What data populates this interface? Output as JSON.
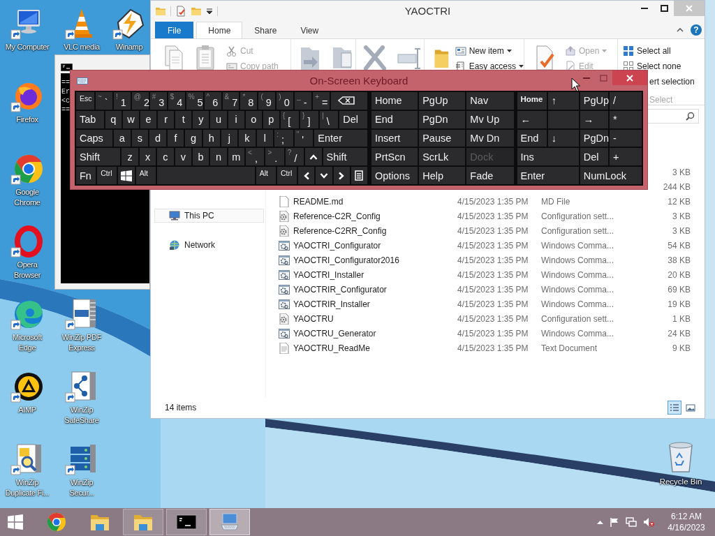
{
  "desktop_icons": [
    {
      "label": "My Computer",
      "kind": "computer"
    },
    {
      "label": "VLC media",
      "kind": "cone"
    },
    {
      "label": "Winamp",
      "kind": "bolt"
    },
    {
      "label": "Firefox",
      "kind": "firefox"
    },
    {
      "label": "Google Chrome",
      "kind": "chrome"
    },
    {
      "label": "Opera Browser",
      "kind": "opera"
    },
    {
      "label": "Microsoft Edge",
      "kind": "edge"
    },
    {
      "label": "WinZip PDF Express",
      "kind": "pdf"
    },
    {
      "label": "AIMP",
      "kind": "aimp"
    },
    {
      "label": "WinZip SafeShare",
      "kind": "share"
    },
    {
      "label": "WinZip Duplicate Fi...",
      "kind": "duplicate"
    },
    {
      "label": "WinZip Secur...",
      "kind": "secure"
    }
  ],
  "recycle_bin": {
    "label": "Recycle Bin"
  },
  "console": {
    "lines": [
      "==",
      "Er",
      "<c",
      "=="
    ]
  },
  "explorer": {
    "title": "YAOCTRI",
    "ribbon_tabs": [
      {
        "label": "File",
        "kind": "file",
        "selected": false
      },
      {
        "label": "Home",
        "kind": "tab",
        "selected": true
      },
      {
        "label": "Share",
        "kind": "tab",
        "selected": false
      },
      {
        "label": "View",
        "kind": "tab",
        "selected": false
      }
    ],
    "help_label": "?",
    "ribbon": {
      "clipboard": [
        {
          "label": "Cut",
          "disabled": true,
          "dropdown": false
        },
        {
          "label": "Copy path",
          "disabled": true,
          "dropdown": false
        }
      ],
      "new": [
        {
          "label": "New item",
          "disabled": false,
          "dropdown": true
        },
        {
          "label": "Easy access",
          "disabled": false,
          "dropdown": true
        }
      ],
      "open": [
        {
          "label": "Open",
          "disabled": true,
          "dropdown": true
        },
        {
          "label": "Edit",
          "disabled": true,
          "dropdown": false
        }
      ],
      "select": [
        {
          "label": "Select all",
          "disabled": false,
          "dropdown": false
        },
        {
          "label": "Select none",
          "disabled": false,
          "dropdown": false
        },
        {
          "label": "ert selection",
          "disabled": false,
          "dropdown": false
        }
      ],
      "select_label": "Select"
    },
    "nav": [
      {
        "label": "This PC",
        "kind": "pc",
        "selected": true
      },
      {
        "label": "Network",
        "kind": "network",
        "selected": false
      }
    ],
    "files": [
      {
        "size": "3 KB"
      },
      {
        "size": "244 KB"
      },
      {
        "name": "README.md",
        "date": "4/15/2023 1:35 PM",
        "type": "MD File",
        "size": "12 KB",
        "kind": "document"
      },
      {
        "name": "Reference-C2R_Config",
        "date": "4/15/2023 1:35 PM",
        "type": "Configuration sett...",
        "size": "3 KB",
        "kind": "settings"
      },
      {
        "name": "Reference-C2RR_Config",
        "date": "4/15/2023 1:35 PM",
        "type": "Configuration sett...",
        "size": "3 KB",
        "kind": "settings"
      },
      {
        "name": "YAOCTRI_Configurator",
        "date": "4/15/2023 1:35 PM",
        "type": "Windows Comma...",
        "size": "54 KB",
        "kind": "script"
      },
      {
        "name": "YAOCTRI_Configurator2016",
        "date": "4/15/2023 1:35 PM",
        "type": "Windows Comma...",
        "size": "38 KB",
        "kind": "script"
      },
      {
        "name": "YAOCTRI_Installer",
        "date": "4/15/2023 1:35 PM",
        "type": "Windows Comma...",
        "size": "20 KB",
        "kind": "script"
      },
      {
        "name": "YAOCTRIR_Configurator",
        "date": "4/15/2023 1:35 PM",
        "type": "Windows Comma...",
        "size": "69 KB",
        "kind": "script"
      },
      {
        "name": "YAOCTRIR_Installer",
        "date": "4/15/2023 1:35 PM",
        "type": "Windows Comma...",
        "size": "19 KB",
        "kind": "script"
      },
      {
        "name": "YAOCTRU",
        "date": "4/15/2023 1:35 PM",
        "type": "Configuration sett...",
        "size": "1 KB",
        "kind": "settings"
      },
      {
        "name": "YAOCTRU_Generator",
        "date": "4/15/2023 1:35 PM",
        "type": "Windows Comma...",
        "size": "24 KB",
        "kind": "script"
      },
      {
        "name": "YAOCTRU_ReadMe",
        "date": "4/15/2023 1:35 PM",
        "type": "Text Document",
        "size": "9 KB",
        "kind": "text"
      }
    ],
    "status": "14 items",
    "view_buttons": [
      {
        "kind": "details",
        "selected": true
      },
      {
        "kind": "thumbnails",
        "selected": false
      }
    ]
  },
  "keyboard": {
    "title": "On-Screen Keyboard",
    "main_rows": [
      [
        {
          "label": "Esc",
          "kind": "small"
        },
        {
          "shift": "~",
          "label": "`",
          "kind": "pair"
        },
        {
          "shift": "!",
          "label": "1",
          "kind": "pair"
        },
        {
          "shift": "@",
          "label": "2",
          "kind": "pair"
        },
        {
          "shift": "#",
          "label": "3",
          "kind": "pair"
        },
        {
          "shift": "$",
          "label": "4",
          "kind": "pair"
        },
        {
          "shift": "%",
          "label": "5",
          "kind": "pair"
        },
        {
          "shift": "^",
          "label": "6",
          "kind": "pair"
        },
        {
          "shift": "&",
          "label": "7",
          "kind": "pair"
        },
        {
          "shift": "*",
          "label": "8",
          "kind": "pair"
        },
        {
          "shift": "(",
          "label": "9",
          "kind": "pair"
        },
        {
          "shift": ")",
          "label": "0",
          "kind": "pair"
        },
        {
          "shift": "_",
          "label": "-",
          "kind": "pair"
        },
        {
          "shift": "+",
          "label": "=",
          "kind": "pair"
        },
        {
          "kind": "backspace"
        }
      ],
      [
        {
          "label": "Tab",
          "kind": "text"
        },
        {
          "label": "q",
          "kind": "letter"
        },
        {
          "label": "w",
          "kind": "letter"
        },
        {
          "label": "e",
          "kind": "letter"
        },
        {
          "label": "r",
          "kind": "letter"
        },
        {
          "label": "t",
          "kind": "letter"
        },
        {
          "label": "y",
          "kind": "letter"
        },
        {
          "label": "u",
          "kind": "letter"
        },
        {
          "label": "i",
          "kind": "letter"
        },
        {
          "label": "o",
          "kind": "letter"
        },
        {
          "label": "p",
          "kind": "letter"
        },
        {
          "shift": "{",
          "label": "[",
          "kind": "pair"
        },
        {
          "shift": "}",
          "label": "]",
          "kind": "pair"
        },
        {
          "shift": "|",
          "label": "\\",
          "kind": "pair"
        },
        {
          "label": "Del",
          "kind": "text"
        }
      ],
      [
        {
          "label": "Caps",
          "kind": "text"
        },
        {
          "label": "a",
          "kind": "letter"
        },
        {
          "label": "s",
          "kind": "letter"
        },
        {
          "label": "d",
          "kind": "letter"
        },
        {
          "label": "f",
          "kind": "letter"
        },
        {
          "label": "g",
          "kind": "letter"
        },
        {
          "label": "h",
          "kind": "letter"
        },
        {
          "label": "j",
          "kind": "letter"
        },
        {
          "label": "k",
          "kind": "letter"
        },
        {
          "label": "l",
          "kind": "letter"
        },
        {
          "shift": ":",
          "label": ";",
          "kind": "pair"
        },
        {
          "shift": "\"",
          "label": "'",
          "kind": "pair"
        },
        {
          "label": "Enter",
          "kind": "text"
        }
      ],
      [
        {
          "label": "Shift",
          "kind": "text"
        },
        {
          "label": "z",
          "kind": "letter"
        },
        {
          "label": "x",
          "kind": "letter"
        },
        {
          "label": "c",
          "kind": "letter"
        },
        {
          "label": "v",
          "kind": "letter"
        },
        {
          "label": "b",
          "kind": "letter"
        },
        {
          "label": "n",
          "kind": "letter"
        },
        {
          "label": "m",
          "kind": "letter"
        },
        {
          "shift": "<",
          "label": ",",
          "kind": "pair"
        },
        {
          "shift": ">",
          "label": ".",
          "kind": "pair"
        },
        {
          "shift": "?",
          "label": "/",
          "kind": "pair"
        },
        {
          "kind": "up"
        },
        {
          "label": "Shift",
          "kind": "text"
        }
      ],
      [
        {
          "label": "Fn",
          "kind": "text"
        },
        {
          "label": "Ctrl",
          "kind": "small"
        },
        {
          "kind": "windows"
        },
        {
          "label": "Alt",
          "kind": "small"
        },
        {
          "kind": "space"
        },
        {
          "label": "Alt",
          "kind": "small"
        },
        {
          "label": "Ctrl",
          "kind": "small"
        },
        {
          "kind": "left"
        },
        {
          "kind": "down"
        },
        {
          "kind": "right"
        },
        {
          "kind": "menu"
        }
      ]
    ],
    "side_rows": [
      [
        {
          "label": "Home",
          "kind": "text",
          "disabled": false
        },
        {
          "label": "PgUp",
          "kind": "text",
          "disabled": false
        },
        {
          "label": "Nav",
          "kind": "text",
          "disabled": false
        },
        {
          "label": "Home",
          "kind": "small",
          "disabled": false
        },
        {
          "label": "↑",
          "kind": "text",
          "disabled": false
        },
        {
          "label": "PgUp",
          "kind": "text",
          "disabled": false
        },
        {
          "label": "/",
          "kind": "text",
          "disabled": false
        }
      ],
      [
        {
          "label": "End",
          "kind": "text",
          "disabled": false
        },
        {
          "label": "PgDn",
          "kind": "text",
          "disabled": false
        },
        {
          "label": "Mv Up",
          "kind": "text",
          "disabled": false
        },
        {
          "label": "←",
          "kind": "text",
          "disabled": false
        },
        {
          "kind": "blank"
        },
        {
          "label": "→",
          "kind": "text",
          "disabled": false
        },
        {
          "label": "*",
          "kind": "text",
          "disabled": false
        }
      ],
      [
        {
          "label": "Insert",
          "kind": "text",
          "disabled": false
        },
        {
          "label": "Pause",
          "kind": "text",
          "disabled": false
        },
        {
          "label": "Mv Dn",
          "kind": "text",
          "disabled": false
        },
        {
          "label": "End",
          "kind": "text",
          "disabled": false
        },
        {
          "label": "↓",
          "kind": "text",
          "disabled": false
        },
        {
          "label": "PgDn",
          "kind": "text",
          "disabled": false
        },
        {
          "label": "-",
          "kind": "text",
          "disabled": false
        }
      ],
      [
        {
          "label": "PrtScn",
          "kind": "text",
          "disabled": false
        },
        {
          "label": "ScrLk",
          "kind": "text",
          "disabled": false
        },
        {
          "label": "Dock",
          "kind": "text",
          "disabled": true
        },
        {
          "label": "Ins",
          "kind": "text",
          "disabled": false
        },
        {
          "label": "Del",
          "kind": "text",
          "disabled": false
        },
        {
          "label": "+",
          "kind": "text",
          "disabled": false
        }
      ],
      [
        {
          "label": "Options",
          "kind": "text",
          "disabled": false
        },
        {
          "label": "Help",
          "kind": "text",
          "disabled": false
        },
        {
          "label": "Fade",
          "kind": "text",
          "disabled": false
        },
        {
          "label": "Enter",
          "kind": "text",
          "disabled": false
        },
        {
          "label": "NumLock",
          "kind": "text",
          "disabled": false
        }
      ]
    ]
  },
  "taskbar": {
    "apps": [
      {
        "kind": "chrome",
        "running": false,
        "selected": false
      },
      {
        "kind": "folder",
        "running": false,
        "selected": false
      },
      {
        "kind": "folder",
        "running": true,
        "selected": false
      },
      {
        "kind": "console",
        "running": true,
        "selected": false
      },
      {
        "kind": "keyboard",
        "running": true,
        "selected": true
      }
    ],
    "volume_muted": true,
    "time": "6:12 AM",
    "date": "4/16/2023"
  }
}
